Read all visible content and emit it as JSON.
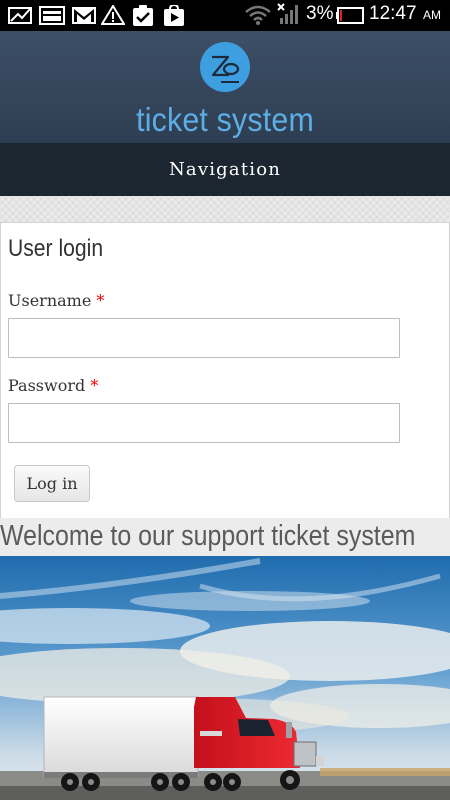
{
  "status_bar": {
    "battery": "3%",
    "time": "12:47",
    "ampm": "AM",
    "icons": [
      "picture-icon",
      "image-icon",
      "gmail-icon",
      "warning-icon",
      "clipboard-check-icon",
      "play-store-icon",
      "wifi-icon",
      "signal-icon",
      "battery-icon"
    ]
  },
  "header": {
    "logo_icon": "zo-logo-icon",
    "site_name": "ticket system",
    "nav_label": "Navigation"
  },
  "login": {
    "title": "User login",
    "username_label": "Username",
    "password_label": "Password",
    "required_mark": "*",
    "username_value": "",
    "password_value": "",
    "submit_label": "Log in"
  },
  "welcome": {
    "heading": "Welcome to our support ticket system"
  },
  "hero": {
    "image": "red-semi-truck-under-blue-sky"
  },
  "colors": {
    "header_bg": "#34465c",
    "nav_bg": "#1c2631",
    "accent_blue": "#5dade6",
    "required_red": "#e00000"
  }
}
